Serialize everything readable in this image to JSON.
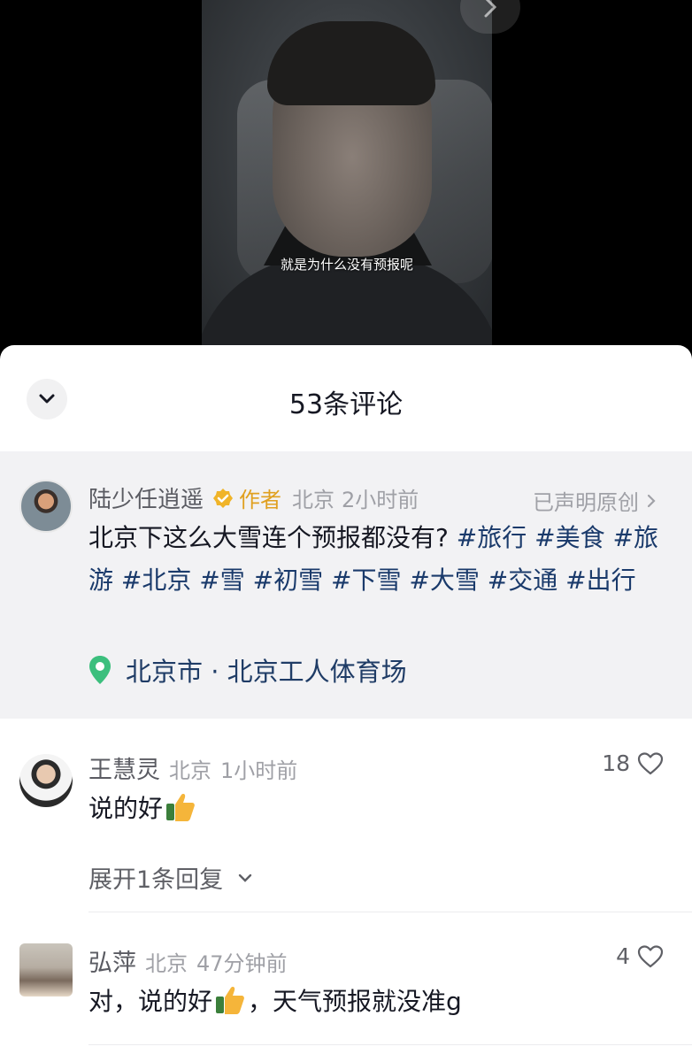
{
  "video": {
    "subtitle": "就是为什么没有预报呢"
  },
  "sheet": {
    "title": "53条评论"
  },
  "author_post": {
    "username": "陆少任逍遥",
    "author_tag": "作者",
    "location_meta": "北京",
    "time": "2小时前",
    "original_label": "已声明原创",
    "caption_text": "北京下这么大雪连个预报都没有? ",
    "hashtags": [
      "#旅行",
      "#美食",
      "#旅游",
      "#北京",
      "#雪",
      "#初雪",
      "#下雪",
      "#大雪",
      "#交通",
      "#出行"
    ],
    "place": "北京市 · 北京工人体育场"
  },
  "comments": [
    {
      "username": "王慧灵",
      "location": "北京",
      "time": "1小时前",
      "text": "说的好",
      "likes": "18",
      "expand_label": "展开1条回复"
    },
    {
      "username": "弘萍",
      "location": "北京",
      "time": "47分钟前",
      "text_before": "对，说的好",
      "text_after": "，天气预报就没准g",
      "likes": "4"
    }
  ],
  "icons": {
    "collapse": "chevron-down-icon",
    "next": "chevron-right-icon",
    "verified": "verified-badge-icon",
    "location": "location-pin-icon",
    "like": "heart-outline-icon",
    "emoji": "thumbs-up-emoji"
  },
  "colors": {
    "hashtag": "#1a3a6b",
    "author_tag": "#e0a020",
    "location_pin": "#3cbf7d",
    "author_block_bg": "#f2f2f4"
  }
}
